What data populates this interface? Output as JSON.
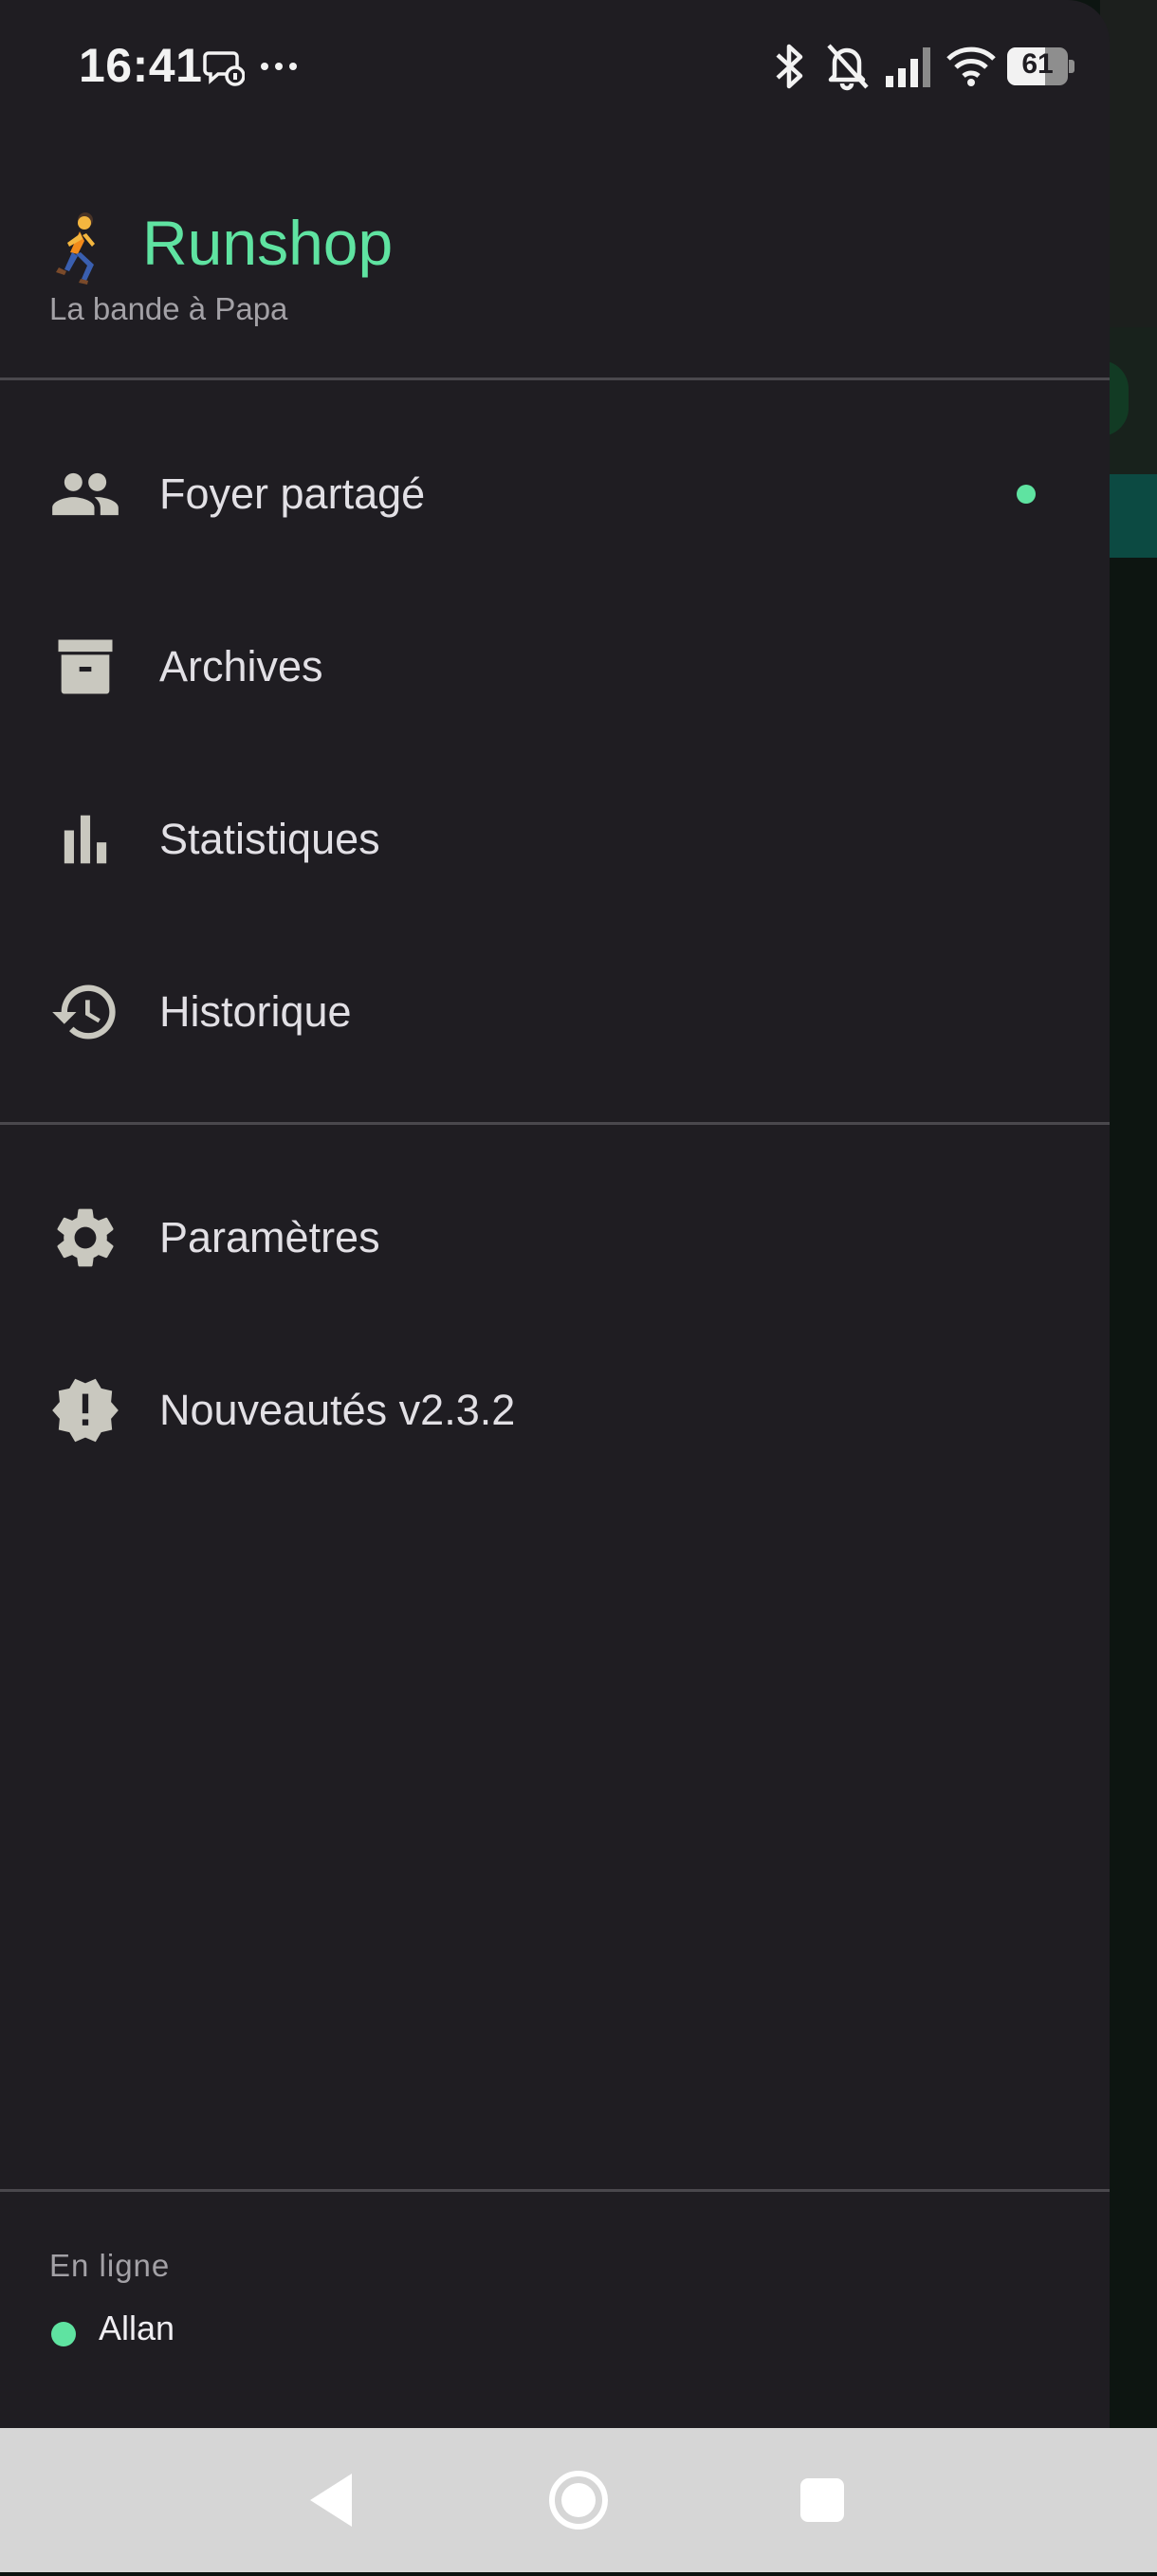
{
  "status_bar": {
    "time": "16:41",
    "battery": "61",
    "icons": [
      "chat-notification-icon",
      "more-dots-icon",
      "bluetooth-icon",
      "notifications-off-icon",
      "signal-icon",
      "wifi-icon",
      "battery-icon"
    ]
  },
  "drawer": {
    "app_emoji": "🏃",
    "app_title": "Runshop",
    "app_subtitle": "La bande à Papa",
    "menu_primary": [
      {
        "label": "Foyer partagé",
        "icon": "group-icon",
        "has_indicator": true
      },
      {
        "label": "Archives",
        "icon": "archive-icon"
      },
      {
        "label": "Statistiques",
        "icon": "bar-chart-icon"
      },
      {
        "label": "Historique",
        "icon": "history-icon"
      }
    ],
    "menu_secondary": [
      {
        "label": "Paramètres",
        "icon": "gear-icon"
      },
      {
        "label": "Nouveautés v2.3.2",
        "icon": "new-release-icon"
      }
    ],
    "online": {
      "title": "En ligne",
      "users": [
        {
          "name": "Allan",
          "status": "online"
        }
      ]
    }
  },
  "colors": {
    "accent": "#5fe3a1",
    "drawer_bg": "#1f1d22",
    "text": "#e2e0e5",
    "muted": "#a3a1a6",
    "nav_bar": "#d6d6d6"
  },
  "nav_bar": {
    "buttons": [
      "back-icon",
      "home-icon",
      "recents-icon"
    ]
  }
}
